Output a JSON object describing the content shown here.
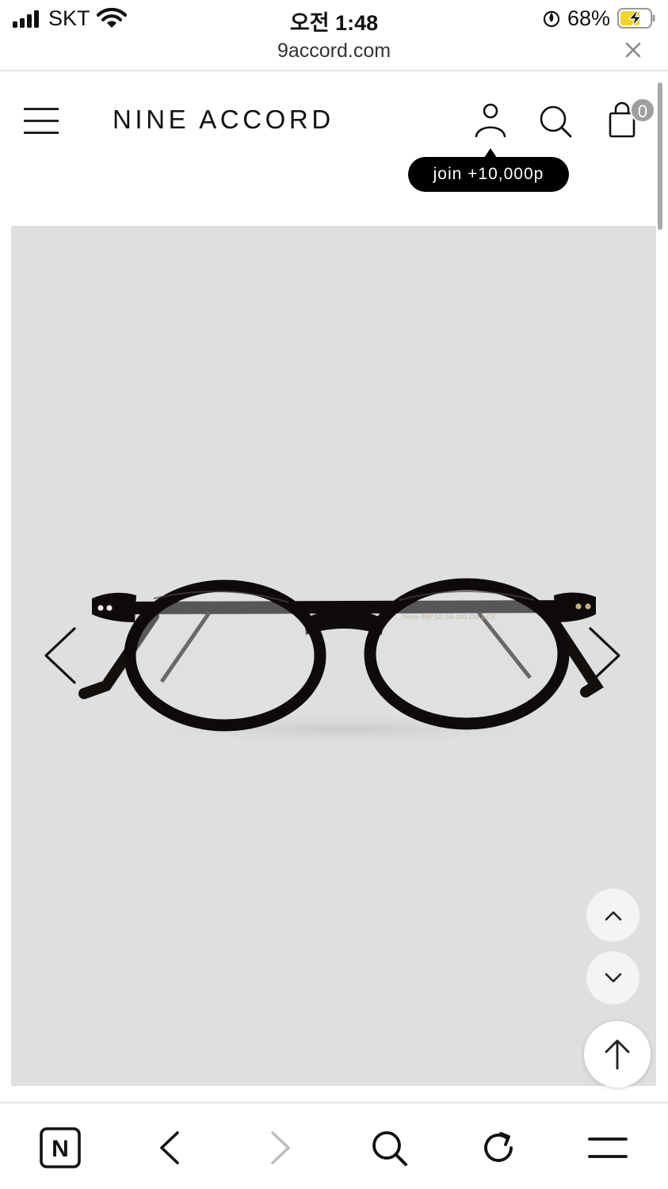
{
  "status_bar": {
    "carrier": "SKT",
    "time": "오전 1:48",
    "battery_percent": "68%",
    "battery_level": 0.68,
    "signal_bars": 4,
    "icons": [
      "signal-icon",
      "wifi-icon",
      "focus-moon-icon",
      "battery-charging-icon"
    ]
  },
  "browser": {
    "url": "9accord.com",
    "close_icon": "close-icon"
  },
  "header": {
    "logo": "NINE ACCORD",
    "cart_count": "0",
    "join_tooltip": "join +10,000p",
    "icons": [
      "menu-icon",
      "user-icon",
      "search-icon",
      "shopping-bag-icon"
    ]
  },
  "product": {
    "image": "black-oval-eyeglasses",
    "temple_print": "Norm IMP  52□18-145  Col.1  CE",
    "background_color": "#dfdfe0",
    "icons": [
      "chevron-left-icon",
      "chevron-right-icon"
    ]
  },
  "floating_buttons": {
    "icons": [
      "chevron-up-icon",
      "chevron-down-icon",
      "arrow-up-icon"
    ]
  },
  "toolbar": {
    "home_label": "N",
    "icons": [
      "naver-home-icon",
      "back-icon",
      "forward-icon",
      "search-icon",
      "reload-icon",
      "menu-icon"
    ]
  }
}
